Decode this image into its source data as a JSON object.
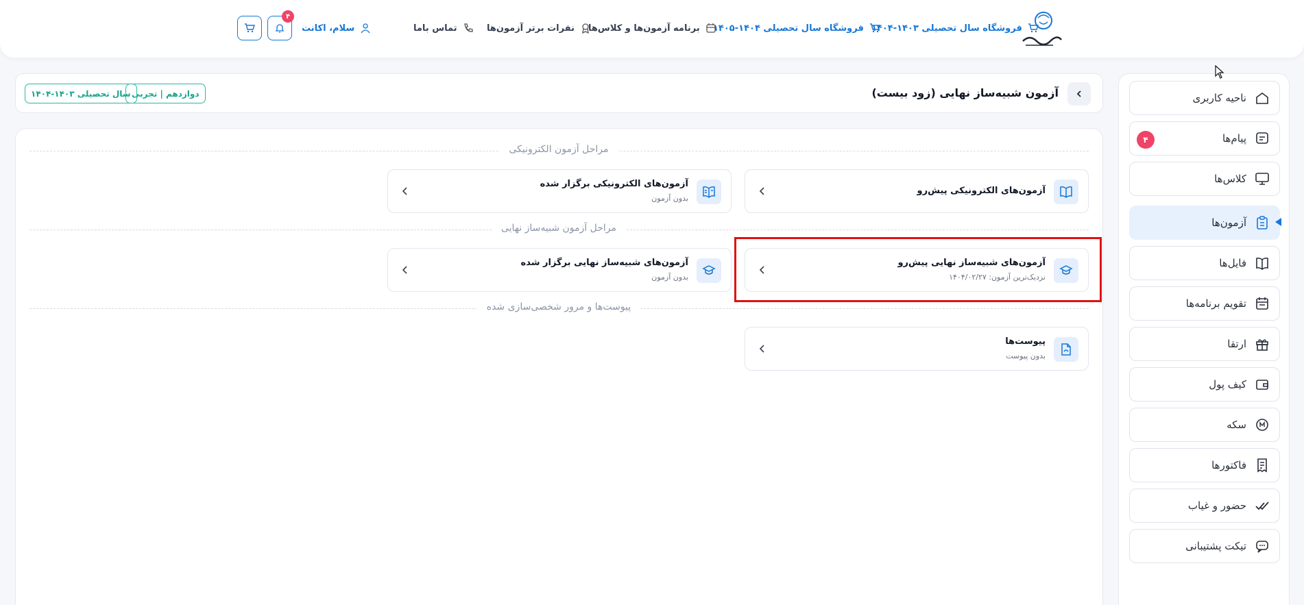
{
  "header": {
    "nav": [
      {
        "label": "فروشگاه سال تحصیلی ۱۴۰۳-۱۴۰۴",
        "icon": "cart-icon"
      },
      {
        "label": "فروشگاه سال تحصیلی ۱۴۰۴-۱۴۰۵",
        "icon": "cart-icon"
      },
      {
        "label": "برنامه آزمون‌ها و کلاس‌ها",
        "icon": "calendar-icon"
      },
      {
        "label": "نفرات برتر آزمون‌ها",
        "icon": "medal-icon"
      },
      {
        "label": "تماس باما",
        "icon": "phone-icon"
      }
    ],
    "user_greeting": "سلام، اکانت",
    "notification_count": "۴"
  },
  "sidebar": {
    "items": [
      {
        "label": "ناحیه کاربری",
        "icon": "home-icon"
      },
      {
        "label": "پیام‌ها",
        "icon": "message-icon",
        "badge": "۴"
      },
      {
        "label": "کلاس‌ها",
        "icon": "monitor-icon"
      },
      {
        "label": "آزمون‌ها",
        "icon": "clipboard-icon",
        "active": true
      },
      {
        "label": "فایل‌ها",
        "icon": "book-icon"
      },
      {
        "label": "تقویم برنامه‌ها",
        "icon": "calendar-icon"
      },
      {
        "label": "ارتقا",
        "icon": "gift-icon"
      },
      {
        "label": "کیف پول",
        "icon": "wallet-icon"
      },
      {
        "label": "سکه",
        "icon": "coin-icon"
      },
      {
        "label": "فاکتورها",
        "icon": "invoice-icon"
      },
      {
        "label": "حضور و غیاب",
        "icon": "double-check-icon"
      },
      {
        "label": "تیکت پشتیبانی",
        "icon": "chat-icon"
      }
    ]
  },
  "page": {
    "title": "آزمون شبیه‌ساز نهایی (زود بیست)",
    "tags": [
      "دوازدهم | تجربی",
      "سال تحصیلی ۱۴۰۳-۱۴۰۴"
    ]
  },
  "sections": [
    {
      "title": "مراحل آزمون الکترونیکی",
      "cards": [
        {
          "title": "آزمون‌های الکترونیکی پیش‌رو",
          "subtitle": "",
          "icon": "open-book-icon"
        },
        {
          "title": "آزمون‌های الکترونیکی برگزار شده",
          "subtitle": "بدون آزمون",
          "icon": "book-check-icon"
        }
      ]
    },
    {
      "title": "مراحل آزمون شبیه‌ساز نهایی",
      "cards": [
        {
          "title": "آزمون‌های شبیه‌ساز نهایی پیش‌رو",
          "subtitle": "نزدیک‌ترین آزمون: ۱۴۰۴/۰۲/۲۷",
          "icon": "graduation-cap-icon"
        },
        {
          "title": "آزمون‌های شبیه‌ساز نهایی برگزار شده",
          "subtitle": "بدون آزمون",
          "icon": "graduation-cap-icon"
        }
      ]
    },
    {
      "title": "پیوست‌ها و مرور شخصی‌سازی شده",
      "cards": [
        {
          "title": "پیوست‌ها",
          "subtitle": "بدون پیوست",
          "icon": "attachment-icon"
        }
      ]
    }
  ],
  "colors": {
    "accent": "#1677d6",
    "badge": "#ef4467",
    "tag": "#2cb7a0",
    "highlight": "#e01010"
  }
}
